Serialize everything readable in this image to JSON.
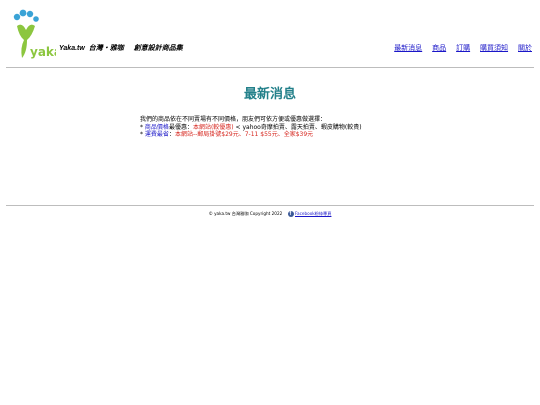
{
  "header": {
    "logo_text": "yaka",
    "brand": "Yaka.tw",
    "tagline_1": "台灣・雅咖",
    "tagline_2": "創意設計商品集"
  },
  "nav": {
    "items": [
      "最新消息",
      "商品",
      "訂購",
      "購買須知",
      "關於"
    ]
  },
  "main": {
    "title": "最新消息",
    "line1": "我們的商品依在不同賣場有不同價格，朋友們可依方便或優惠做選擇：",
    "line2_bullet": "* ",
    "line2_label": "商品價格",
    "line2_mid": "最優惠：",
    "line2_red": "本網站(較優惠)",
    "line2_rest": " < yahoo奇摩拍賣、露天拍賣、蝦皮購物(較貴)",
    "line3_bullet": "* ",
    "line3_label": "運費最省",
    "line3_mid": "：",
    "line3_red": "本網站--郵局掛號$29元、7-11 $55元、全家$39元"
  },
  "footer": {
    "copyright": "© yaka.tw 台灣雅咖 Copyright 2022",
    "fb_link": "Facebook粉絲專頁"
  },
  "colors": {
    "title": "#23808a",
    "link": "#1a16c8",
    "highlight": "#d6261e",
    "logo_green": "#8cc63f",
    "logo_blue": "#3aa3d6"
  }
}
